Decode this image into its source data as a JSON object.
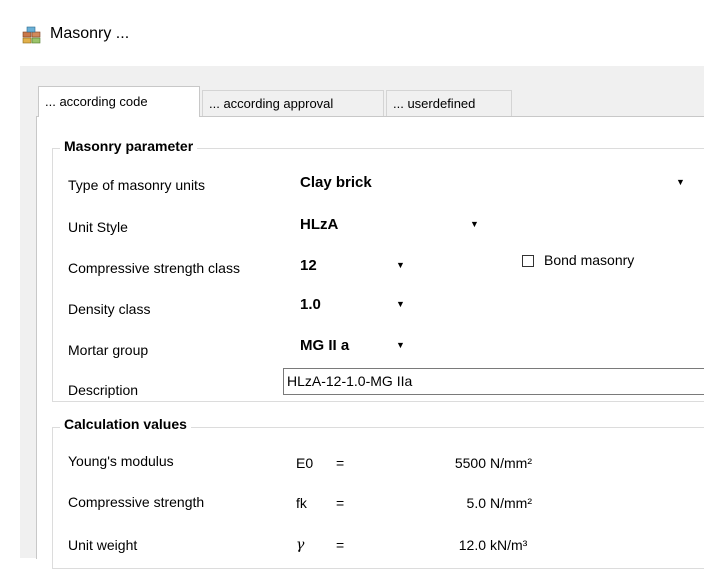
{
  "window": {
    "title": "Masonry ...",
    "icon": "masonry-bricks-icon"
  },
  "tabs": [
    {
      "label": "... according code",
      "active": true
    },
    {
      "label": "... according approval",
      "active": false
    },
    {
      "label": "... userdefined",
      "active": false
    }
  ],
  "masonry_parameter": {
    "title": "Masonry parameter",
    "type_of_units": {
      "label": "Type of masonry units",
      "value": "Clay brick"
    },
    "unit_style": {
      "label": "Unit Style",
      "value": "HLzA"
    },
    "strength_class": {
      "label": "Compressive strength class",
      "value": "12"
    },
    "bond_masonry": {
      "label": "Bond masonry",
      "checked": false
    },
    "density_class": {
      "label": "Density class",
      "value": "1.0"
    },
    "mortar_group": {
      "label": "Mortar group",
      "value": "MG II a"
    },
    "description": {
      "label": "Description",
      "value": "HLzA-12-1.0-MG IIa"
    }
  },
  "calculation_values": {
    "title": "Calculation values",
    "rows": [
      {
        "label": "Young's modulus",
        "symbol": "E0",
        "eq": "=",
        "value": "5500",
        "unit": "N/mm²"
      },
      {
        "label": "Compressive strength",
        "symbol": "fk",
        "eq": "=",
        "value": "5.0",
        "unit": "N/mm²"
      },
      {
        "label": "Unit weight",
        "symbol": "γ",
        "eq": "=",
        "value": "12.0",
        "unit": "kN/m³"
      }
    ]
  },
  "colors": {
    "window_bg": "#ffffff",
    "dialog_bg": "#f0f0f0",
    "groupbox_border": "#dcdcdc"
  }
}
